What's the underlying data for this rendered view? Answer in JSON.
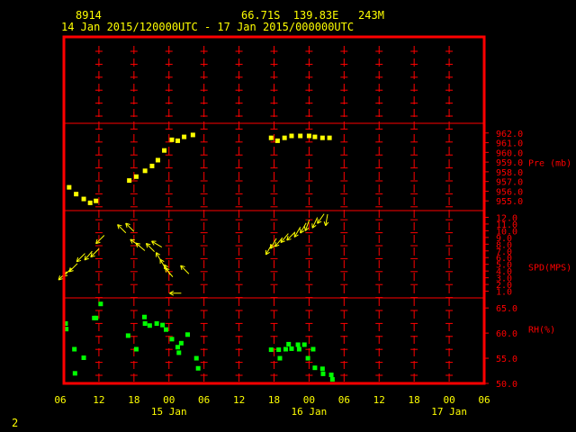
{
  "header": {
    "station": "8914",
    "location": "66.71S  139.83E   243M",
    "period": "14 Jan 2015/120000UTC - 17 Jan 2015/000000UTC"
  },
  "corner_label": "2",
  "colors": {
    "background": "#000000",
    "frame": "#ff0000",
    "grid": "#ff0000",
    "text": "#ffff00",
    "pressure": "#ffff00",
    "wind": "#ffff00",
    "rh": "#00ff00"
  },
  "chart_data": {
    "type": "scatter",
    "x_axis": {
      "range_hours": [
        -6,
        66
      ],
      "hour_labels": [
        "06",
        "12",
        "18",
        "00",
        "06",
        "12",
        "18",
        "00",
        "06",
        "12",
        "18",
        "00",
        "06"
      ],
      "date_labels": [
        {
          "hour": 12,
          "label": "15 Jan"
        },
        {
          "hour": 36,
          "label": "16 Jan"
        },
        {
          "hour": 60,
          "label": "17 Jan"
        }
      ]
    },
    "panels": [
      {
        "name": "pressure",
        "label": "Pre (mb)",
        "ylim": [
          954,
          963
        ],
        "ticks": [
          "962.0",
          "961.0",
          "960.0",
          "959.0",
          "958.0",
          "957.0",
          "956.0",
          "955.0"
        ],
        "series": [
          {
            "marker": "square",
            "points": [
              [
                -5.1,
                956.4
              ],
              [
                -3.9,
                955.7
              ],
              [
                -2.6,
                955.2
              ],
              [
                -1.5,
                954.8
              ],
              [
                -0.5,
                955.0
              ],
              [
                5.2,
                957.1
              ],
              [
                6.4,
                957.5
              ],
              [
                7.9,
                958.1
              ],
              [
                9.1,
                958.6
              ],
              [
                10.1,
                959.2
              ],
              [
                11.2,
                960.2
              ],
              [
                12.5,
                961.3
              ],
              [
                13.5,
                961.2
              ],
              [
                14.6,
                961.6
              ],
              [
                16.1,
                961.8
              ],
              [
                29.5,
                961.5
              ],
              [
                30.6,
                961.2
              ],
              [
                31.8,
                961.5
              ],
              [
                33.0,
                961.7
              ],
              [
                34.5,
                961.7
              ],
              [
                36.0,
                961.7
              ],
              [
                37.0,
                961.6
              ],
              [
                38.3,
                961.5
              ],
              [
                39.5,
                961.5
              ]
            ]
          }
        ]
      },
      {
        "name": "wind",
        "label": "SPD(MPS)",
        "ylim": [
          0,
          13
        ],
        "ticks": [
          "12.0",
          "11.0",
          "10.0",
          "9.0",
          "8.0",
          "7.0",
          "6.0",
          "5.0",
          "4.0",
          "3.0",
          "2.0",
          "1.0"
        ],
        "series": [
          {
            "marker": "arrow",
            "points": [
              {
                "x": -6.2,
                "y": 3.3,
                "dir": 225
              },
              {
                "x": -5.4,
                "y": 3.8,
                "dir": 225
              },
              {
                "x": -4.4,
                "y": 4.5,
                "dir": 225
              },
              {
                "x": -3.1,
                "y": 6.0,
                "dir": 225
              },
              {
                "x": -1.8,
                "y": 6.3,
                "dir": 220
              },
              {
                "x": -0.7,
                "y": 6.7,
                "dir": 225
              },
              {
                "x": 0.2,
                "y": 8.7,
                "dir": 225
              },
              {
                "x": 3.9,
                "y": 10.3,
                "dir": 315
              },
              {
                "x": 5.3,
                "y": 10.5,
                "dir": 315
              },
              {
                "x": 6.2,
                "y": 8.2,
                "dir": 305
              },
              {
                "x": 7.1,
                "y": 7.6,
                "dir": 310
              },
              {
                "x": 8.8,
                "y": 7.5,
                "dir": 315
              },
              {
                "x": 9.9,
                "y": 8.0,
                "dir": 300
              },
              {
                "x": 10.3,
                "y": 6.0,
                "dir": 330
              },
              {
                "x": 11.0,
                "y": 5.0,
                "dir": 330
              },
              {
                "x": 11.7,
                "y": 4.2,
                "dir": 330
              },
              {
                "x": 12.0,
                "y": 3.8,
                "dir": 320
              },
              {
                "x": 13.1,
                "y": 0.7,
                "dir": 270
              },
              {
                "x": 14.7,
                "y": 4.2,
                "dir": 315
              },
              {
                "x": 29.1,
                "y": 7.2,
                "dir": 210
              },
              {
                "x": 29.9,
                "y": 8.1,
                "dir": 210
              },
              {
                "x": 30.8,
                "y": 8.3,
                "dir": 220
              },
              {
                "x": 31.8,
                "y": 8.9,
                "dir": 220
              },
              {
                "x": 32.9,
                "y": 9.2,
                "dir": 225
              },
              {
                "x": 34.0,
                "y": 9.8,
                "dir": 210
              },
              {
                "x": 35.0,
                "y": 10.4,
                "dir": 210
              },
              {
                "x": 35.7,
                "y": 10.8,
                "dir": 200
              },
              {
                "x": 37.0,
                "y": 11.2,
                "dir": 205
              },
              {
                "x": 38.0,
                "y": 11.8,
                "dir": 215
              },
              {
                "x": 39.0,
                "y": 11.6,
                "dir": 190
              }
            ]
          }
        ]
      },
      {
        "name": "rh",
        "label": "RH(%)",
        "ylim": [
          50,
          67
        ],
        "ticks": [
          "65.0",
          "60.0",
          "55.0",
          "50.0"
        ],
        "series": [
          {
            "marker": "square",
            "points": [
              [
                -5.7,
                61.9
              ],
              [
                -5.6,
                60.8
              ],
              [
                -4.2,
                56.8
              ],
              [
                -4.1,
                52.0
              ],
              [
                -2.6,
                55.1
              ],
              [
                -0.8,
                63.0
              ],
              [
                -0.5,
                63.0
              ],
              [
                0.3,
                65.8
              ],
              [
                5.0,
                59.5
              ],
              [
                6.4,
                56.8
              ],
              [
                7.8,
                63.2
              ],
              [
                7.9,
                61.9
              ],
              [
                8.7,
                61.5
              ],
              [
                9.9,
                61.9
              ],
              [
                10.9,
                61.6
              ],
              [
                11.5,
                60.7
              ],
              [
                12.5,
                58.8
              ],
              [
                13.5,
                57.2
              ],
              [
                13.7,
                56.1
              ],
              [
                14.1,
                58.0
              ],
              [
                15.2,
                59.7
              ],
              [
                16.7,
                55.0
              ],
              [
                17.0,
                53.0
              ],
              [
                29.5,
                56.7
              ],
              [
                30.8,
                56.7
              ],
              [
                31.0,
                55.0
              ],
              [
                32.0,
                56.8
              ],
              [
                32.5,
                57.8
              ],
              [
                33.0,
                56.9
              ],
              [
                34.1,
                57.7
              ],
              [
                34.3,
                56.8
              ],
              [
                35.2,
                57.7
              ],
              [
                35.8,
                55.0
              ],
              [
                36.7,
                56.8
              ],
              [
                37.0,
                53.1
              ],
              [
                38.3,
                52.9
              ],
              [
                38.4,
                51.9
              ],
              [
                39.8,
                51.7
              ],
              [
                40.0,
                50.8
              ]
            ]
          }
        ]
      }
    ]
  }
}
